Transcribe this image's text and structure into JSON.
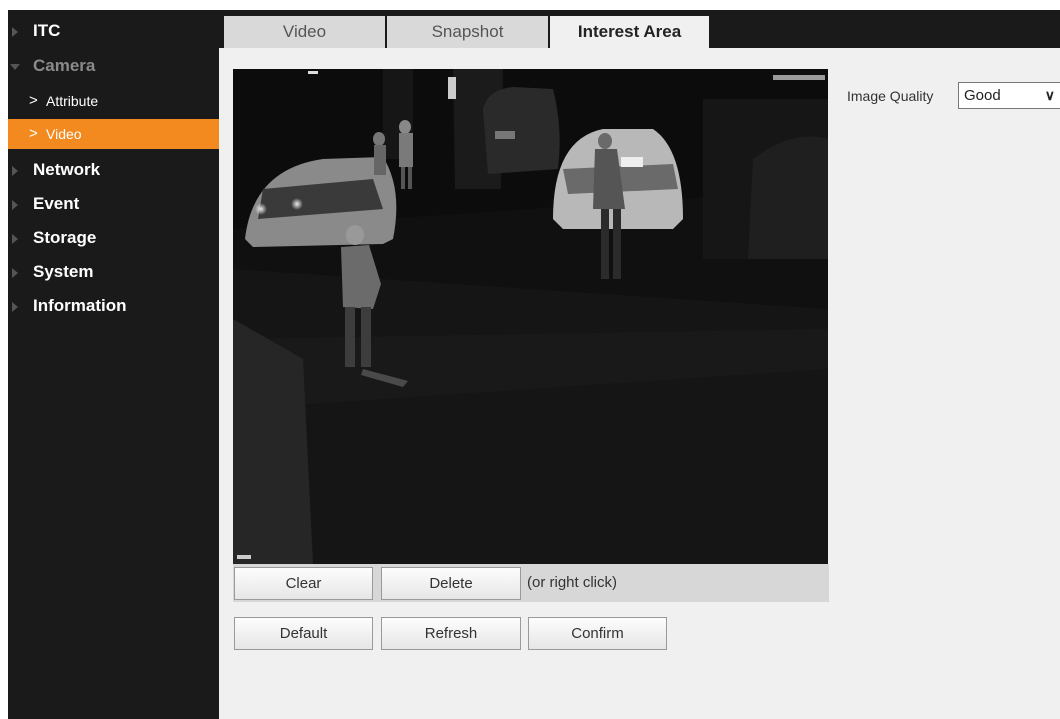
{
  "sidebar": {
    "items": [
      {
        "label": "ITC"
      },
      {
        "label": "Camera"
      },
      {
        "label": "Attribute"
      },
      {
        "label": "Video"
      },
      {
        "label": "Network"
      },
      {
        "label": "Event"
      },
      {
        "label": "Storage"
      },
      {
        "label": "System"
      },
      {
        "label": "Information"
      }
    ],
    "chevron": ">"
  },
  "tabs": [
    {
      "label": "Video"
    },
    {
      "label": "Snapshot"
    },
    {
      "label": "Interest Area"
    }
  ],
  "image_quality": {
    "label": "Image Quality",
    "value": "Good",
    "chevron": "∨"
  },
  "video_controls": {
    "clear_label": "Clear",
    "delete_label": "Delete",
    "hint": "(or right click)"
  },
  "actions": {
    "default_label": "Default",
    "refresh_label": "Refresh",
    "confirm_label": "Confirm"
  },
  "colors": {
    "sidebar_bg": "#1a1a1a",
    "active_item": "#f38a1f",
    "panel_bg": "#f0f0f0"
  }
}
